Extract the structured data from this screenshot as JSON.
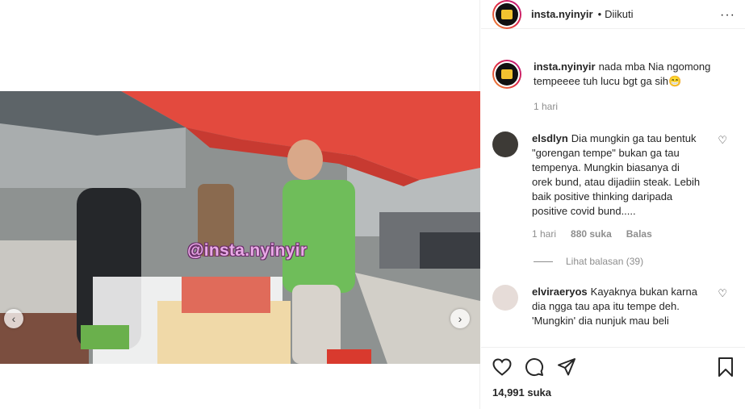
{
  "post": {
    "watermark": "@insta.nyinyir"
  },
  "header": {
    "username": "insta.nyinyir",
    "separator": "•",
    "follow_status": "Diikuti",
    "more": "···"
  },
  "caption": {
    "username": "insta.nyinyir",
    "text": "nada mba Nia ngomong tempeeee tuh lucu bgt ga sih😁",
    "time": "1 hari"
  },
  "comments": [
    {
      "username": "elsdlyn",
      "text": "Dia mungkin ga tau bentuk \"gorengan tempe\" bukan ga tau tempenya. Mungkin biasanya di orek bund, atau dijadiin steak. Lebih baik positive thinking daripada positive covid bund.....",
      "time": "1 hari",
      "likes": "880 suka",
      "reply": "Balas",
      "view_replies": "Lihat balasan (39)"
    },
    {
      "username": "elviraeryos",
      "text": "Kayaknya bukan karna dia ngga tau apa itu tempe deh. 'Mungkin' dia nunjuk mau beli"
    }
  ],
  "actions": {
    "likes": "14,991 suka"
  },
  "icons": [
    "heart-icon",
    "comment-icon",
    "share-icon",
    "bookmark-icon",
    "chevron-left-icon",
    "chevron-right-icon"
  ]
}
